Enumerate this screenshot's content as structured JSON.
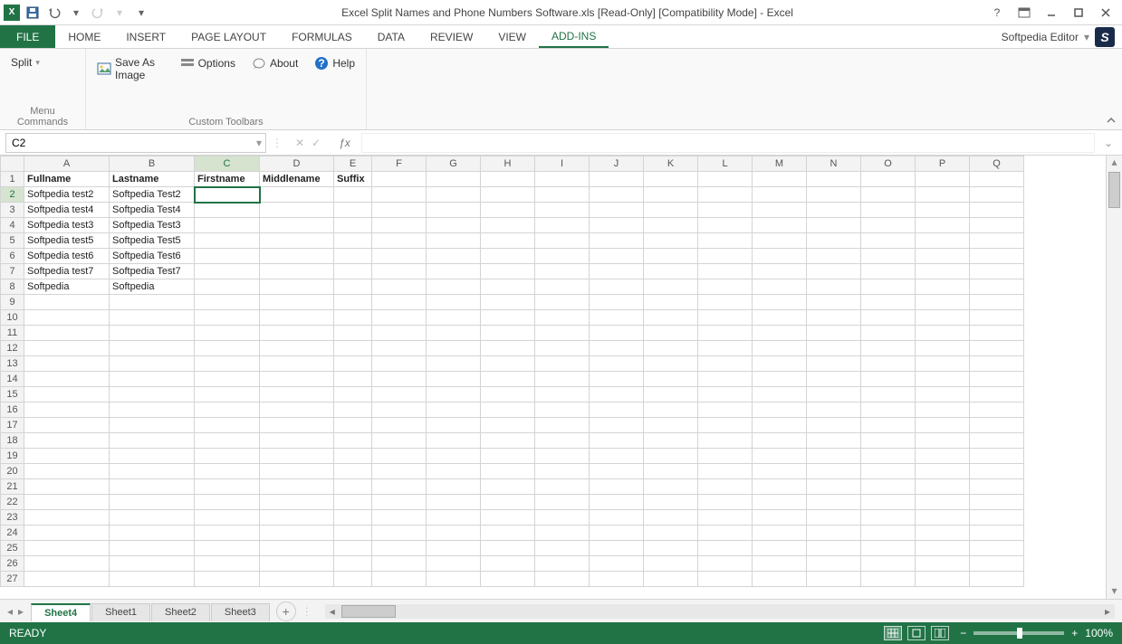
{
  "title": "Excel Split Names and Phone Numbers Software.xls  [Read-Only]   [Compatibility Mode] - Excel",
  "ribbon": {
    "file": "FILE",
    "tabs": [
      "HOME",
      "INSERT",
      "PAGE LAYOUT",
      "FORMULAS",
      "DATA",
      "REVIEW",
      "VIEW",
      "ADD-INS"
    ],
    "active_tab": "ADD-INS",
    "editor": "Softpedia Editor"
  },
  "addins": {
    "split": "Split",
    "save_image": "Save As Image",
    "options": "Options",
    "about": "About",
    "help": "Help",
    "group1": "Menu Commands",
    "group2": "Custom Toolbars"
  },
  "namebox": "C2",
  "formula": "",
  "columns": [
    "A",
    "B",
    "C",
    "D",
    "E",
    "F",
    "G",
    "H",
    "I",
    "J",
    "K",
    "L",
    "M",
    "N",
    "O",
    "P",
    "Q"
  ],
  "col_widths": {
    "A": 94,
    "B": 94,
    "C": 72,
    "D": 82,
    "E": 42,
    "_default": 60
  },
  "row_count": 27,
  "headers": {
    "A": "Fullname",
    "B": "Lastname",
    "C": "Firstname",
    "D": "Middlename",
    "E": "Suffix"
  },
  "rows": [
    {
      "A": "Softpedia test2",
      "B": "Softpedia Test2"
    },
    {
      "A": "Softpedia test4",
      "B": "Softpedia Test4"
    },
    {
      "A": "Softpedia test3",
      "B": "Softpedia Test3"
    },
    {
      "A": "Softpedia test5",
      "B": "Softpedia Test5"
    },
    {
      "A": "Softpedia test6",
      "B": "Softpedia Test6"
    },
    {
      "A": "Softpedia test7",
      "B": "Softpedia Test7"
    },
    {
      "A": "Softpedia",
      "B": "Softpedia"
    }
  ],
  "selected_cell": {
    "row": 2,
    "col": "C"
  },
  "sheets": {
    "active": "Sheet4",
    "list": [
      "Sheet4",
      "Sheet1",
      "Sheet2",
      "Sheet3"
    ]
  },
  "status": {
    "ready": "READY",
    "zoom": "100%"
  }
}
